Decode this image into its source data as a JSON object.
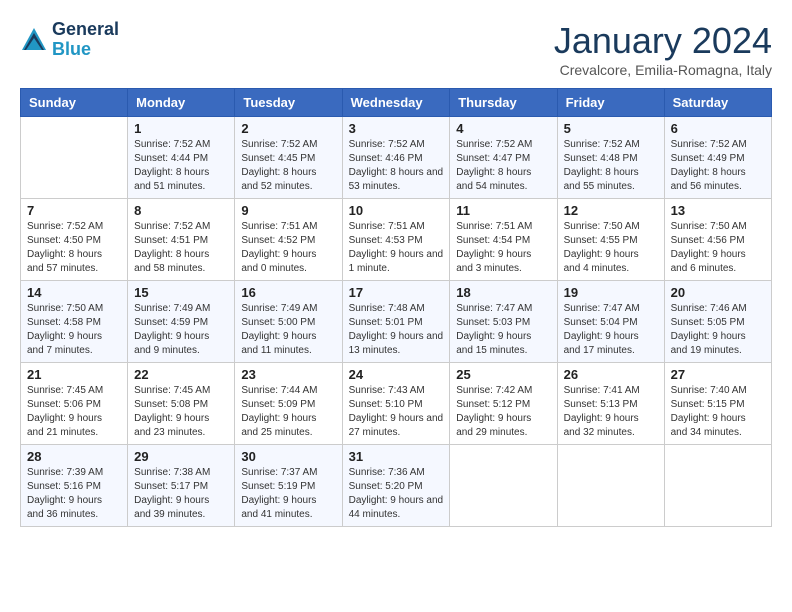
{
  "logo": {
    "line1": "General",
    "line2": "Blue"
  },
  "title": "January 2024",
  "subtitle": "Crevalcore, Emilia-Romagna, Italy",
  "weekdays": [
    "Sunday",
    "Monday",
    "Tuesday",
    "Wednesday",
    "Thursday",
    "Friday",
    "Saturday"
  ],
  "weeks": [
    [
      {
        "day": "",
        "sunrise": "",
        "sunset": "",
        "daylight": ""
      },
      {
        "day": "1",
        "sunrise": "Sunrise: 7:52 AM",
        "sunset": "Sunset: 4:44 PM",
        "daylight": "Daylight: 8 hours and 51 minutes."
      },
      {
        "day": "2",
        "sunrise": "Sunrise: 7:52 AM",
        "sunset": "Sunset: 4:45 PM",
        "daylight": "Daylight: 8 hours and 52 minutes."
      },
      {
        "day": "3",
        "sunrise": "Sunrise: 7:52 AM",
        "sunset": "Sunset: 4:46 PM",
        "daylight": "Daylight: 8 hours and 53 minutes."
      },
      {
        "day": "4",
        "sunrise": "Sunrise: 7:52 AM",
        "sunset": "Sunset: 4:47 PM",
        "daylight": "Daylight: 8 hours and 54 minutes."
      },
      {
        "day": "5",
        "sunrise": "Sunrise: 7:52 AM",
        "sunset": "Sunset: 4:48 PM",
        "daylight": "Daylight: 8 hours and 55 minutes."
      },
      {
        "day": "6",
        "sunrise": "Sunrise: 7:52 AM",
        "sunset": "Sunset: 4:49 PM",
        "daylight": "Daylight: 8 hours and 56 minutes."
      }
    ],
    [
      {
        "day": "7",
        "sunrise": "Sunrise: 7:52 AM",
        "sunset": "Sunset: 4:50 PM",
        "daylight": "Daylight: 8 hours and 57 minutes."
      },
      {
        "day": "8",
        "sunrise": "Sunrise: 7:52 AM",
        "sunset": "Sunset: 4:51 PM",
        "daylight": "Daylight: 8 hours and 58 minutes."
      },
      {
        "day": "9",
        "sunrise": "Sunrise: 7:51 AM",
        "sunset": "Sunset: 4:52 PM",
        "daylight": "Daylight: 9 hours and 0 minutes."
      },
      {
        "day": "10",
        "sunrise": "Sunrise: 7:51 AM",
        "sunset": "Sunset: 4:53 PM",
        "daylight": "Daylight: 9 hours and 1 minute."
      },
      {
        "day": "11",
        "sunrise": "Sunrise: 7:51 AM",
        "sunset": "Sunset: 4:54 PM",
        "daylight": "Daylight: 9 hours and 3 minutes."
      },
      {
        "day": "12",
        "sunrise": "Sunrise: 7:50 AM",
        "sunset": "Sunset: 4:55 PM",
        "daylight": "Daylight: 9 hours and 4 minutes."
      },
      {
        "day": "13",
        "sunrise": "Sunrise: 7:50 AM",
        "sunset": "Sunset: 4:56 PM",
        "daylight": "Daylight: 9 hours and 6 minutes."
      }
    ],
    [
      {
        "day": "14",
        "sunrise": "Sunrise: 7:50 AM",
        "sunset": "Sunset: 4:58 PM",
        "daylight": "Daylight: 9 hours and 7 minutes."
      },
      {
        "day": "15",
        "sunrise": "Sunrise: 7:49 AM",
        "sunset": "Sunset: 4:59 PM",
        "daylight": "Daylight: 9 hours and 9 minutes."
      },
      {
        "day": "16",
        "sunrise": "Sunrise: 7:49 AM",
        "sunset": "Sunset: 5:00 PM",
        "daylight": "Daylight: 9 hours and 11 minutes."
      },
      {
        "day": "17",
        "sunrise": "Sunrise: 7:48 AM",
        "sunset": "Sunset: 5:01 PM",
        "daylight": "Daylight: 9 hours and 13 minutes."
      },
      {
        "day": "18",
        "sunrise": "Sunrise: 7:47 AM",
        "sunset": "Sunset: 5:03 PM",
        "daylight": "Daylight: 9 hours and 15 minutes."
      },
      {
        "day": "19",
        "sunrise": "Sunrise: 7:47 AM",
        "sunset": "Sunset: 5:04 PM",
        "daylight": "Daylight: 9 hours and 17 minutes."
      },
      {
        "day": "20",
        "sunrise": "Sunrise: 7:46 AM",
        "sunset": "Sunset: 5:05 PM",
        "daylight": "Daylight: 9 hours and 19 minutes."
      }
    ],
    [
      {
        "day": "21",
        "sunrise": "Sunrise: 7:45 AM",
        "sunset": "Sunset: 5:06 PM",
        "daylight": "Daylight: 9 hours and 21 minutes."
      },
      {
        "day": "22",
        "sunrise": "Sunrise: 7:45 AM",
        "sunset": "Sunset: 5:08 PM",
        "daylight": "Daylight: 9 hours and 23 minutes."
      },
      {
        "day": "23",
        "sunrise": "Sunrise: 7:44 AM",
        "sunset": "Sunset: 5:09 PM",
        "daylight": "Daylight: 9 hours and 25 minutes."
      },
      {
        "day": "24",
        "sunrise": "Sunrise: 7:43 AM",
        "sunset": "Sunset: 5:10 PM",
        "daylight": "Daylight: 9 hours and 27 minutes."
      },
      {
        "day": "25",
        "sunrise": "Sunrise: 7:42 AM",
        "sunset": "Sunset: 5:12 PM",
        "daylight": "Daylight: 9 hours and 29 minutes."
      },
      {
        "day": "26",
        "sunrise": "Sunrise: 7:41 AM",
        "sunset": "Sunset: 5:13 PM",
        "daylight": "Daylight: 9 hours and 32 minutes."
      },
      {
        "day": "27",
        "sunrise": "Sunrise: 7:40 AM",
        "sunset": "Sunset: 5:15 PM",
        "daylight": "Daylight: 9 hours and 34 minutes."
      }
    ],
    [
      {
        "day": "28",
        "sunrise": "Sunrise: 7:39 AM",
        "sunset": "Sunset: 5:16 PM",
        "daylight": "Daylight: 9 hours and 36 minutes."
      },
      {
        "day": "29",
        "sunrise": "Sunrise: 7:38 AM",
        "sunset": "Sunset: 5:17 PM",
        "daylight": "Daylight: 9 hours and 39 minutes."
      },
      {
        "day": "30",
        "sunrise": "Sunrise: 7:37 AM",
        "sunset": "Sunset: 5:19 PM",
        "daylight": "Daylight: 9 hours and 41 minutes."
      },
      {
        "day": "31",
        "sunrise": "Sunrise: 7:36 AM",
        "sunset": "Sunset: 5:20 PM",
        "daylight": "Daylight: 9 hours and 44 minutes."
      },
      {
        "day": "",
        "sunrise": "",
        "sunset": "",
        "daylight": ""
      },
      {
        "day": "",
        "sunrise": "",
        "sunset": "",
        "daylight": ""
      },
      {
        "day": "",
        "sunrise": "",
        "sunset": "",
        "daylight": ""
      }
    ]
  ]
}
